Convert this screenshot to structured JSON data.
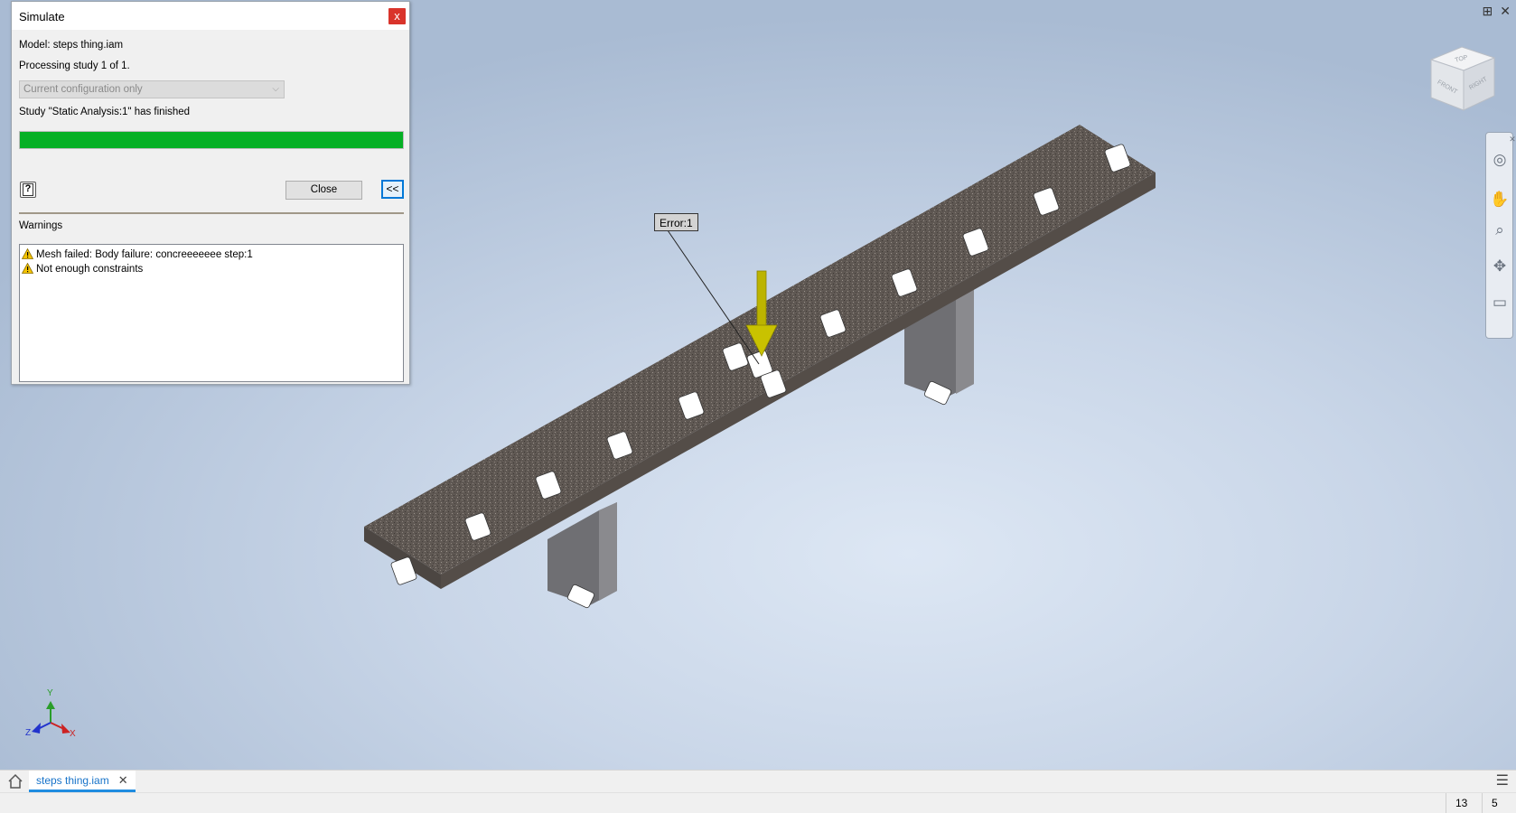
{
  "dialog": {
    "title": "Simulate",
    "close_x": "x",
    "model_line": "Model: steps thing.iam",
    "processing_line": "Processing study 1 of 1.",
    "config_select": "Current configuration only",
    "study_status": "Study \"Static Analysis:1\" has finished",
    "progress_percent": 100,
    "help_label": "?",
    "close_label": "Close",
    "collapse_label": "<<",
    "warnings_label": "Warnings",
    "warnings": [
      "Mesh failed: Body failure: concreeeeeee step:1",
      "Not enough constraints"
    ]
  },
  "viewport": {
    "error_label": "Error:1",
    "viewcube": {
      "top": "TOP",
      "front": "FRONT",
      "right": "RIGHT"
    },
    "axes": {
      "x": "X",
      "y": "Y",
      "z": "Z"
    },
    "load_color": "#c9c200",
    "concrete_color": "#5c5550"
  },
  "tabs": {
    "document": "steps thing.iam",
    "close": "✕"
  },
  "status": {
    "count1": "13",
    "count2": "5"
  },
  "icons": [
    "home-icon",
    "menu-icon",
    "warning-icon",
    "help-icon",
    "orbit-icon",
    "pan-icon",
    "zoom-icon",
    "look-icon",
    "view-icon"
  ]
}
